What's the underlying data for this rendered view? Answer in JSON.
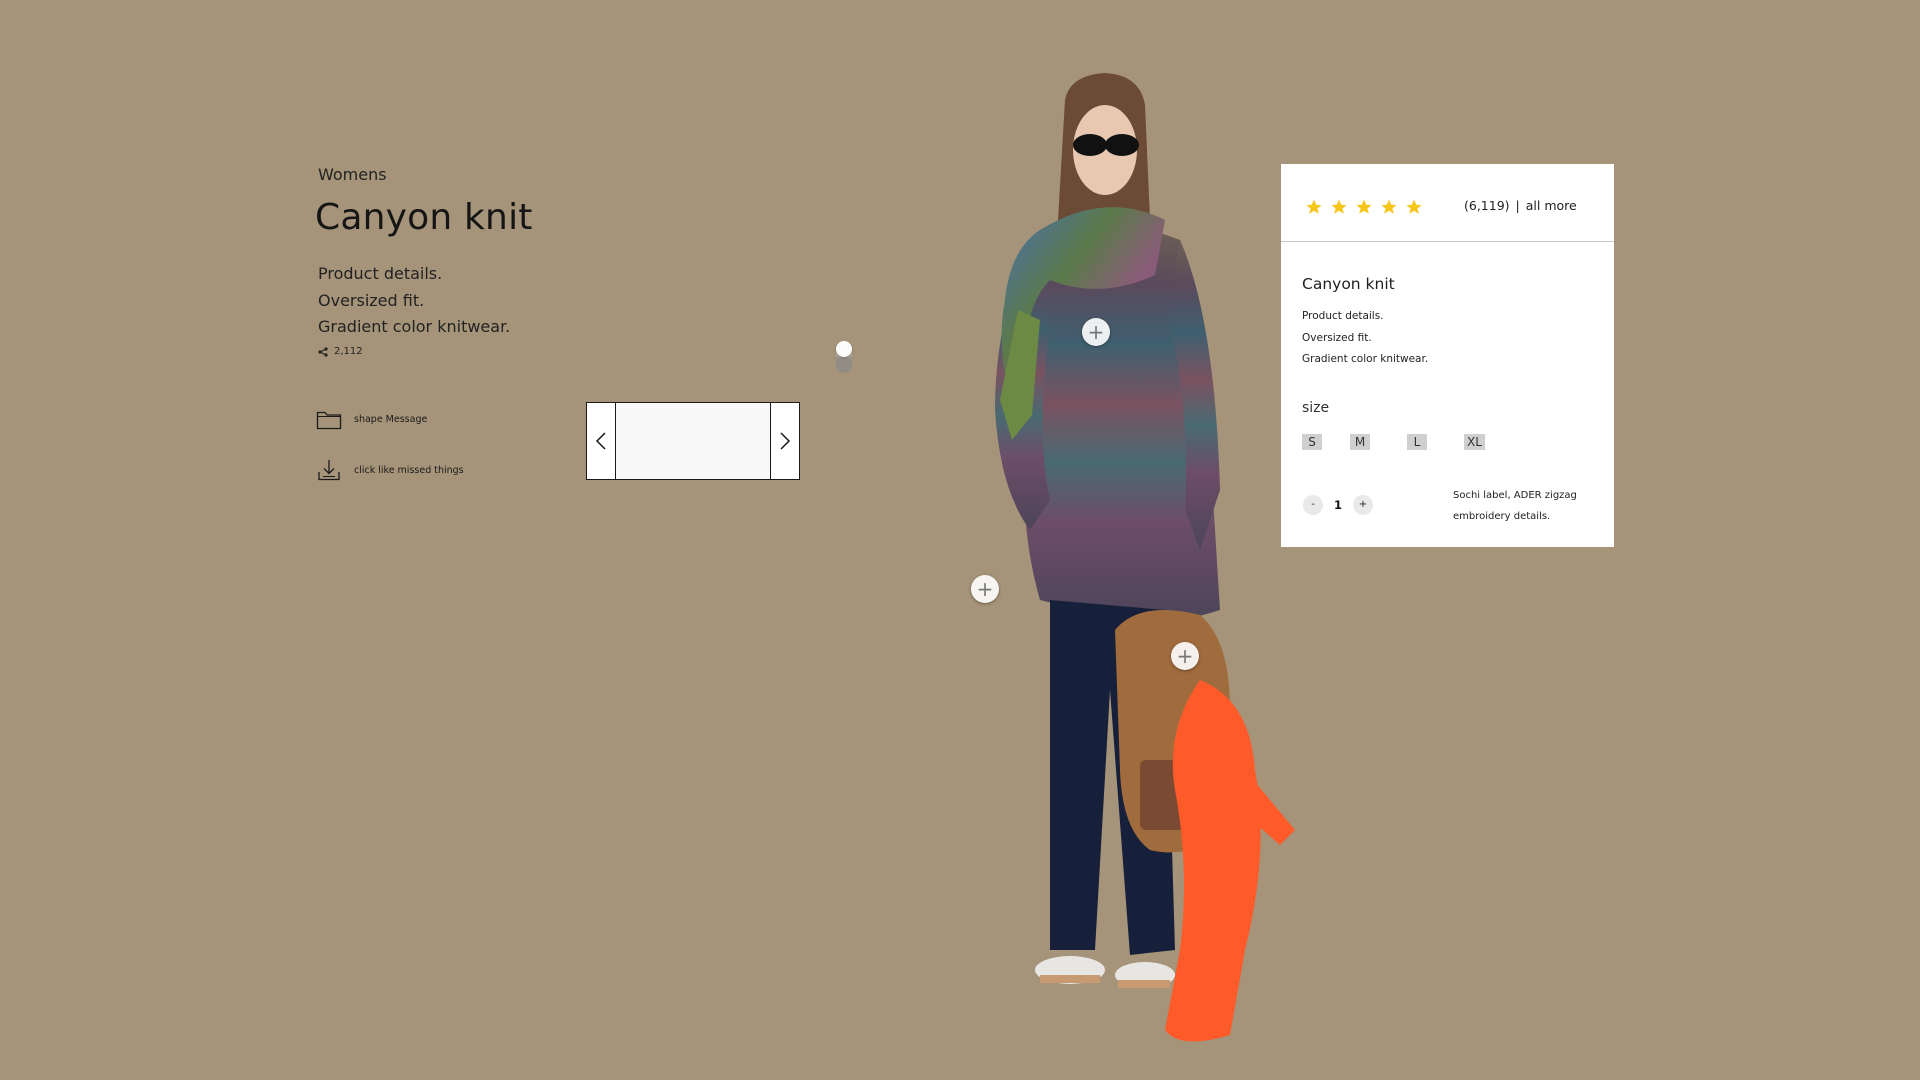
{
  "product": {
    "category": "Womens",
    "title": "Canyon knit",
    "details": [
      "Product details.",
      "Oversized fit.",
      "Gradient color knitwear."
    ],
    "share_count": "2,112"
  },
  "actions": {
    "message_label": "shape Message",
    "missed_label": "click like missed things"
  },
  "card": {
    "stars": 5,
    "star_color": "#f5c518",
    "review_count": "(6,119)",
    "separator": "|",
    "all_more": "all more",
    "title": "Canyon knit",
    "details": [
      "Product details.",
      "Oversized fit.",
      "Gradient color knitwear."
    ],
    "size_label": "size",
    "sizes": [
      "S",
      "M",
      "L",
      "XL"
    ],
    "qty_minus": "-",
    "quantity": "1",
    "qty_plus": "+",
    "note_line1": "Sochi label, ADER zigzag",
    "note_line2": "embroidery details."
  },
  "hotspots": {
    "symbol": "+"
  },
  "colors": {
    "background": "#a59479",
    "accent_star": "#f5c518",
    "scarf": "#ff5a2a"
  },
  "icons": [
    "share-icon",
    "folder-icon",
    "download-icon",
    "chevron-left-icon",
    "chevron-right-icon",
    "star-icon",
    "plus-icon"
  ]
}
